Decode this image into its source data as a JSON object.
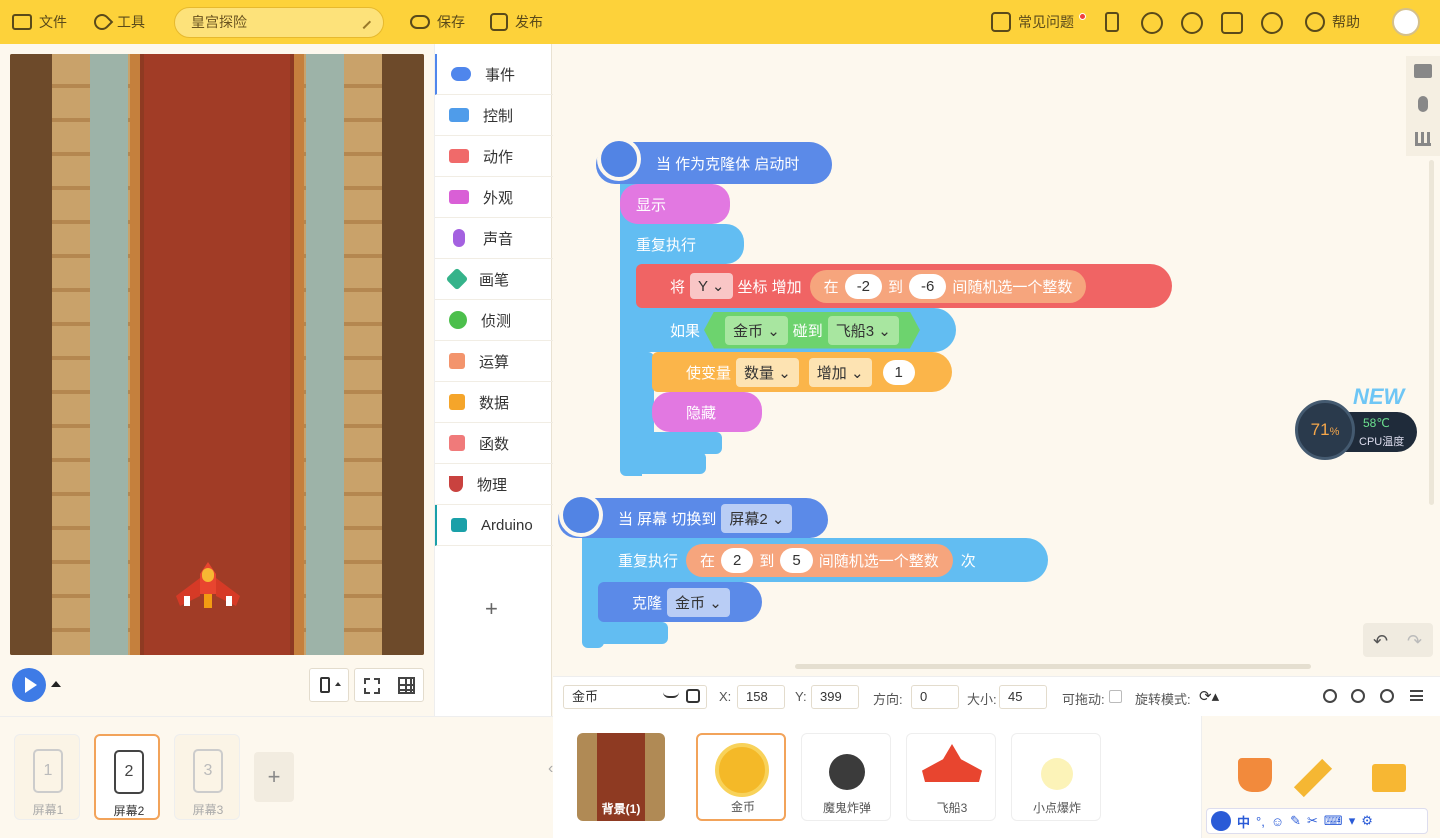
{
  "topbar": {
    "file": "文件",
    "tools": "工具",
    "project_name": "皇宫探险",
    "save": "保存",
    "publish": "发布",
    "faq": "常见问题",
    "help": "帮助"
  },
  "stage_controls": {
    "play_icon": "play-icon",
    "device_icon": "phone-icon",
    "fullscreen_icon": "fullscreen-icon",
    "grid_icon": "grid-icon"
  },
  "categories": [
    {
      "label": "事件",
      "color": "#4f86ec"
    },
    {
      "label": "控制",
      "color": "#4f9cea"
    },
    {
      "label": "动作",
      "color": "#f06a6a"
    },
    {
      "label": "外观",
      "color": "#d95fd6"
    },
    {
      "label": "声音",
      "color": "#a461e0"
    },
    {
      "label": "画笔",
      "color": "#35b38a"
    },
    {
      "label": "侦测",
      "color": "#4cbf4c"
    },
    {
      "label": "运算",
      "color": "#f3946c"
    },
    {
      "label": "数据",
      "color": "#f5a52a"
    },
    {
      "label": "函数",
      "color": "#f07a7a"
    },
    {
      "label": "物理",
      "color": "#c9423f"
    },
    {
      "label": "Arduino",
      "color": "#1aa0a8"
    }
  ],
  "blocks": {
    "hat1": "当 作为克隆体 启动时",
    "show": "显示",
    "repeat_forever": "重复执行",
    "change_coord": {
      "prefix": "将",
      "axis": "Y",
      "middle": "坐标 增加",
      "in": "在",
      "from": "-2",
      "to_word": "到",
      "to": "-6",
      "suffix": "间随机选一个整数"
    },
    "if": {
      "label": "如果",
      "sprite": "金币",
      "touch": "碰到",
      "target": "飞船3"
    },
    "change_var": {
      "label": "使变量",
      "var": "数量",
      "op": "增加",
      "value": "1"
    },
    "hide": "隐藏",
    "hat2": {
      "label": "当 屏幕 切换到",
      "screen": "屏幕2"
    },
    "repeat_n": {
      "label": "重复执行",
      "in": "在",
      "from": "2",
      "to_word": "到",
      "to": "5",
      "suffix": "间随机选一个整数",
      "times": "次"
    },
    "clone": {
      "label": "克隆",
      "target": "金币"
    }
  },
  "cpu_widget": {
    "new_badge": "NEW",
    "percent": "71",
    "percent_sign": "%",
    "temp": "58℃",
    "label": "CPU温度"
  },
  "properties": {
    "sprite_name": "金币",
    "x_label": "X:",
    "x": "158",
    "y_label": "Y:",
    "y": "399",
    "dir_label": "方向:",
    "dir": "0",
    "size_label": "大小:",
    "size": "45",
    "drag_label": "可拖动:",
    "rot_label": "旋转模式:"
  },
  "screens": [
    {
      "num": "1",
      "label": "屏幕1"
    },
    {
      "num": "2",
      "label": "屏幕2"
    },
    {
      "num": "3",
      "label": "屏幕3"
    }
  ],
  "sprites": {
    "background": "背景(1)",
    "items": [
      "金币",
      "魔鬼炸弹",
      "飞船3",
      "小点爆炸"
    ]
  },
  "ime": {
    "label": "中"
  }
}
